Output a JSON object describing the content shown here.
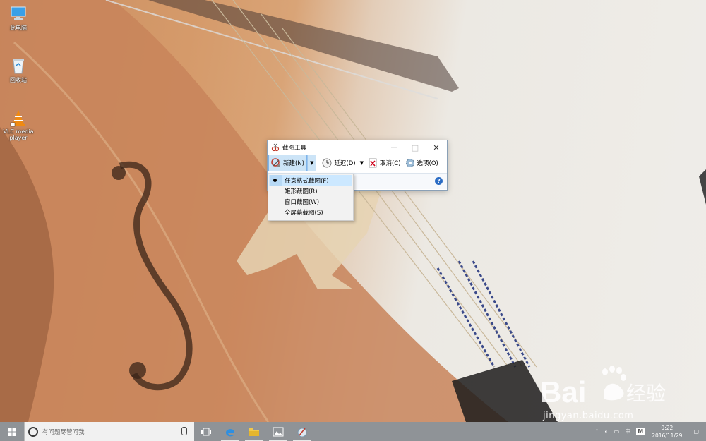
{
  "desktop": {
    "icons": [
      {
        "label": "此电脑",
        "icon": "this-pc-icon"
      },
      {
        "label": "回收站",
        "icon": "recycle-bin-icon"
      },
      {
        "label": "VLC media player",
        "icon": "vlc-icon"
      }
    ]
  },
  "snipping_tool": {
    "title": "截图工具",
    "toolbar": {
      "new_label": "新建(N)",
      "delay_label": "延迟(D)",
      "cancel_label": "取消(C)",
      "options_label": "选项(O)"
    },
    "help_symbol": "?",
    "minimize_symbol": "—",
    "maximize_symbol": "□",
    "close_symbol": "✕"
  },
  "new_menu": {
    "items": [
      {
        "label": "任意格式截图(F)",
        "selected": true
      },
      {
        "label": "矩形截图(R)",
        "selected": false
      },
      {
        "label": "窗口截图(W)",
        "selected": false
      },
      {
        "label": "全屏幕截图(S)",
        "selected": false
      }
    ]
  },
  "taskbar": {
    "search_placeholder": "有问题尽管问我",
    "tray": {
      "ime_label": "中",
      "ime_mode": "M",
      "time": "0:22",
      "date": "2016/11/29"
    }
  },
  "watermark": {
    "brand": "Bai",
    "brand_suffix": "经验",
    "url": "jingyan.baidu.com"
  },
  "colors": {
    "accent": "#0078d7",
    "menu_hover": "#cce8ff",
    "taskbar": "#8f9397"
  }
}
